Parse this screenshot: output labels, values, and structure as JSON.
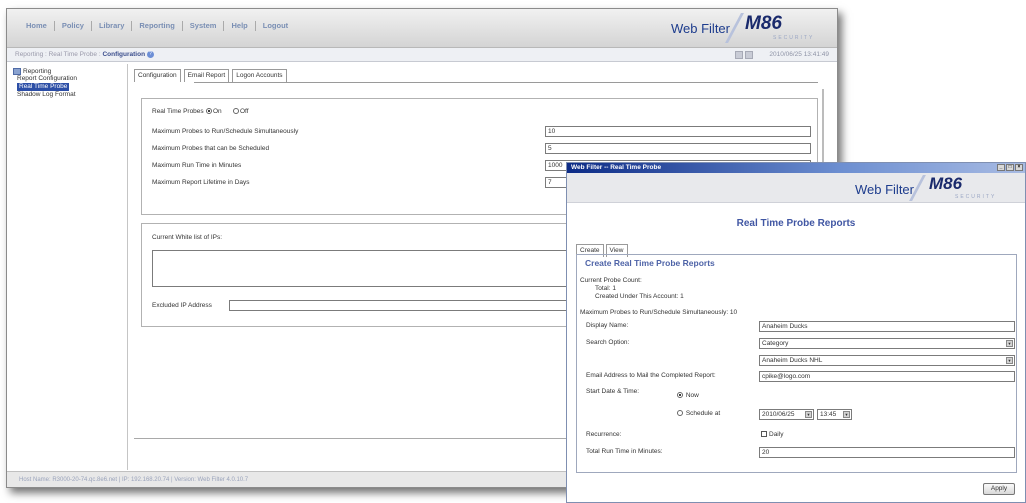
{
  "main": {
    "nav": [
      "Home",
      "Policy",
      "Library",
      "Reporting",
      "System",
      "Help",
      "Logout"
    ],
    "brand": "Web Filter",
    "logo": "M86",
    "logo_sub": "SECURITY",
    "breadcrumb_prefix": "Reporting : Real Time Probe : ",
    "breadcrumb_current": "Configuration",
    "timestamp": "2010/06/25 13:41:49",
    "sidebar": {
      "root": "Reporting",
      "items": [
        "Report Configuration",
        "Real Time Probe",
        "Shadow Log Format"
      ],
      "selected": "Real Time Probe"
    },
    "tabs": [
      "Configuration",
      "Email Report",
      "Logon Accounts"
    ],
    "settings": {
      "real_time_probes_label": "Real Time Probes",
      "on_label": "On",
      "off_label": "Off",
      "rows": [
        {
          "label": "Maximum Probes to Run/Schedule Simultaneously",
          "value": "10"
        },
        {
          "label": "Maximum Probes that can be Scheduled",
          "value": "5"
        },
        {
          "label": "Maximum Run Time in Minutes",
          "value": "1000"
        },
        {
          "label": "Maximum Report Lifetime in Days",
          "value": "7"
        }
      ]
    },
    "whitelist": {
      "title": "Current White list of IPs:",
      "excluded_label": "Excluded IP Address",
      "excluded_value": ""
    },
    "status": "Host Name: R3000-20-74.qc.8e6.net  |  IP: 192.168.20.74  |  Version: Web Filter 4.0.10.7"
  },
  "popup": {
    "title": "Web Filter -- Real Time Probe",
    "brand": "Web Filter",
    "logo": "M86",
    "logo_sub": "SECURITY",
    "heading": "Real Time Probe Reports",
    "tabs": [
      "Create",
      "View"
    ],
    "section_title": "Create Real Time Probe Reports",
    "probe_count_label": "Current Probe Count:",
    "total_label": "Total: 1",
    "created_label": "Created Under This Account: 1",
    "max_label": "Maximum Probes to Run/Schedule Simultaneously: 10",
    "display_name_label": "Display Name:",
    "display_name_value": "Anaheim Ducks",
    "search_option_label": "Search Option:",
    "search_option_value": "Category",
    "search_option_sub_value": "Anaheim Ducks NHL",
    "email_label": "Email Address to Mail the Completed Report:",
    "email_value": "cpike@logo.com",
    "start_label": "Start Date & Time:",
    "now_label": "Now",
    "schedule_label": "Schedule at",
    "date_value": "2010/06/25",
    "time_value": "13:45",
    "recurrence_label": "Recurrence:",
    "daily_label": "Daily",
    "run_time_label": "Total Run Time in Minutes:",
    "run_time_value": "20",
    "apply_label": "Apply"
  }
}
